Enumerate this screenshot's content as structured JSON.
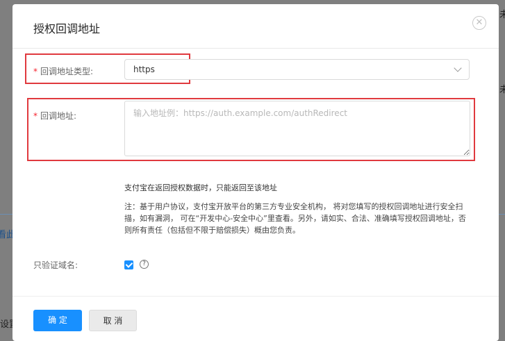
{
  "background": {
    "fragments": [
      "未",
      "未",
      "看此",
      "设置"
    ]
  },
  "modal": {
    "title": "授权回调地址",
    "close_icon": "close-circle-icon"
  },
  "form": {
    "callback_type": {
      "label": "回调地址类型:",
      "required_mark": "*",
      "value": "https",
      "icon": "chevron-down-icon"
    },
    "callback_url": {
      "label": "回调地址:",
      "required_mark": "*",
      "value": "",
      "placeholder": "输入地址例：https://auth.example.com/authRedirect"
    },
    "help_primary": "支付宝在返回授权数据时，只能返回至该地址",
    "help_note": "注：基于用户协议，支付宝开放平台的第三方专业安全机构， 将对您填写的授权回调地址进行安全扫描，如有漏洞， 可在“开发中心-安全中心”里查看。另外，请如实、合法、准确填写授权回调地址，否则所有责任（包括但不限于赔偿损失）概由您负责。",
    "verify_domain": {
      "label": "只验证域名:",
      "checked": true,
      "help_icon": "question-circle-icon"
    }
  },
  "footer": {
    "confirm_label": "确 定",
    "cancel_label": "取 消"
  },
  "colors": {
    "primary": "#1890ff",
    "required": "#f5222d",
    "highlight": "#e0393e"
  }
}
